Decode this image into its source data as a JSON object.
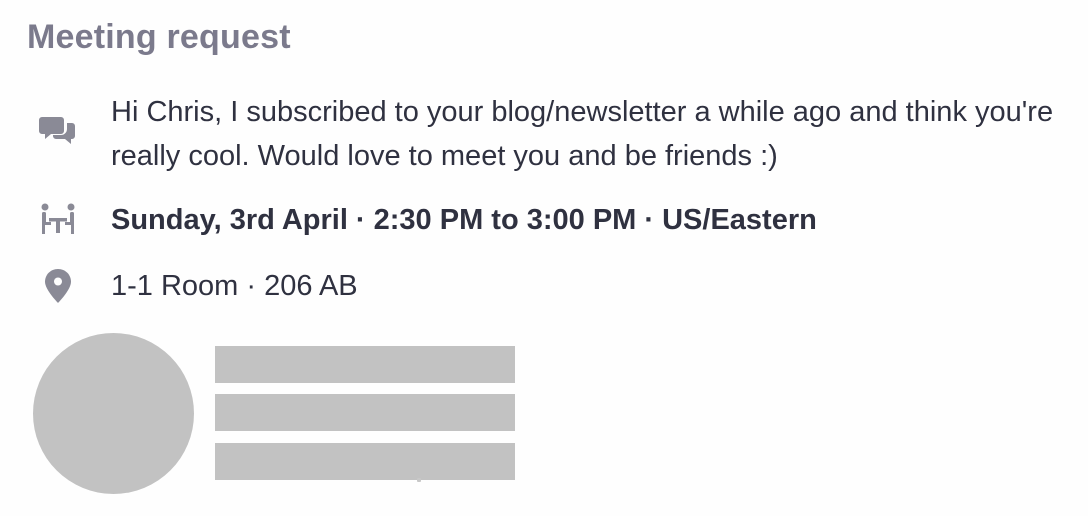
{
  "meeting": {
    "title": "Meeting request",
    "message": "Hi Chris, I subscribed to your blog/newsletter a while ago and think you're really cool. Would love to meet you and be friends :)",
    "when": "Sunday, 3rd April · 2:30 PM to 3:00 PM · US/Eastern",
    "where": "1-1 Room · 206 AB"
  },
  "icons": {
    "message": "chat-bubbles-icon",
    "when": "meeting-table-icon",
    "where": "location-pin-icon"
  },
  "colors": {
    "title": "#7b7a8c",
    "text": "#2f3140",
    "icon": "#8a8a96",
    "placeholder": "#c2c2c2",
    "background": "#fefefe"
  }
}
